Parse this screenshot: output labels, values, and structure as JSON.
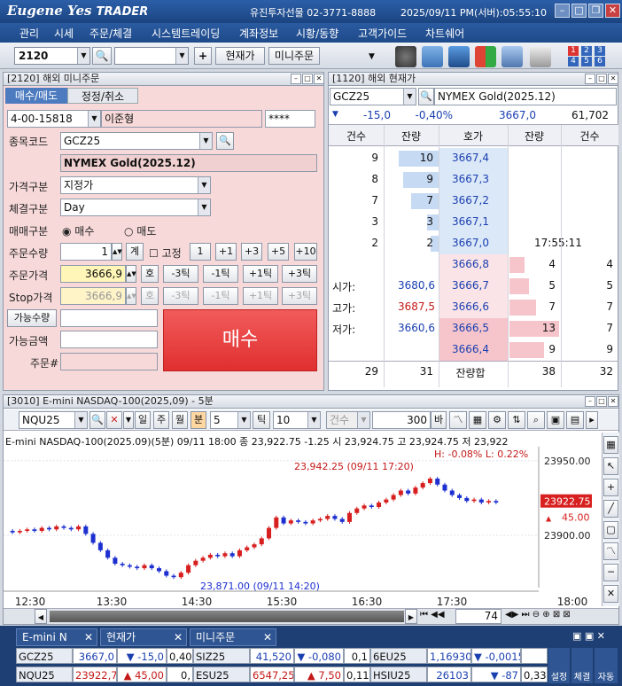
{
  "app": {
    "logo_main": "Eugene Yes",
    "logo_sub": "TRADER",
    "company": "유진투자선물 02-3771-8888",
    "datetime": "2025/09/11  PM(서버):05:55:10"
  },
  "menu": [
    "관리",
    "시세",
    "주문/체결",
    "시스템트레이딩",
    "계좌정보",
    "시황/동향",
    "고객가이드",
    "차트쉐어"
  ],
  "toolbar": {
    "screen_no": "2120",
    "btn_price": "현재가",
    "btn_mini": "미니주문",
    "numgrid": [
      "1",
      "2",
      "3",
      "4",
      "5",
      "6"
    ]
  },
  "order": {
    "title": "[2120] 해외 미니주문",
    "tab_buy": "매수/매도",
    "tab_modify": "정정/취소",
    "account": "4-00-15818",
    "name": "이준형",
    "password": "****",
    "lbl_code": "종목코드",
    "code": "GCZ25",
    "product": "NYMEX Gold(2025.12)",
    "lbl_pricetype": "가격구분",
    "pricetype": "지정가",
    "lbl_fill": "체결구분",
    "fill": "Day",
    "lbl_side": "매매구분",
    "buy": "매수",
    "sell": "매도",
    "lbl_qty": "주문수량",
    "qty": "1",
    "qty_btn": "계",
    "fix": "고정",
    "qty_btns": [
      "1",
      "+1",
      "+3",
      "+5",
      "+10"
    ],
    "lbl_price": "주문가격",
    "price": "3666,9",
    "ho": "호",
    "tick_btns": [
      "-3틱",
      "-1틱",
      "+1틱",
      "+3틱"
    ],
    "lbl_stop": "Stop가격",
    "stop": "3666,9",
    "lbl_avail_qty": "가능수량",
    "lbl_avail_amt": "가능금액",
    "lbl_order_no": "주문#",
    "submit": "매수"
  },
  "price": {
    "title": "[1120] 해외 현재가",
    "code": "GCZ25",
    "product": "NYMEX Gold(2025.12)",
    "change": "-15,0",
    "pct": "-0,40%",
    "last": "3667,0",
    "volume": "61,702",
    "headers": [
      "건수",
      "잔량",
      "호가",
      "잔량",
      "건수"
    ],
    "asks": [
      {
        "cnt": "9",
        "qty": "10",
        "price": "3667,4",
        "q": 10
      },
      {
        "cnt": "8",
        "qty": "9",
        "price": "3667,3",
        "q": 9
      },
      {
        "cnt": "7",
        "qty": "7",
        "price": "3667,2",
        "q": 7
      },
      {
        "cnt": "3",
        "qty": "3",
        "price": "3667,1",
        "q": 3
      },
      {
        "cnt": "2",
        "qty": "2",
        "price": "3667,0",
        "q": 2
      }
    ],
    "time": "17:55:11",
    "bids": [
      {
        "price": "3666,8",
        "qty": "4",
        "cnt": "4",
        "q": 4
      },
      {
        "price": "3666,7",
        "qty": "5",
        "cnt": "5",
        "q": 5
      },
      {
        "price": "3666,6",
        "qty": "7",
        "cnt": "7",
        "q": 7
      },
      {
        "price": "3666,5",
        "qty": "13",
        "cnt": "7",
        "q": 13
      },
      {
        "price": "3666,4",
        "qty": "9",
        "cnt": "9",
        "q": 9
      }
    ],
    "open_lbl": "시가:",
    "open": "3680,6",
    "high_lbl": "고가:",
    "high": "3687,5",
    "low_lbl": "저가:",
    "low": "3660,6",
    "tot": {
      "cnt_l": "29",
      "qty_l": "31",
      "label": "잔량합",
      "qty_r": "38",
      "cnt_r": "32"
    }
  },
  "chart": {
    "title": "[3010] E-mini NASDAQ-100(2025,09) - 5분",
    "code": "NQU25",
    "period_btns": [
      "일",
      "주",
      "월",
      "분"
    ],
    "interval": "5",
    "tick_lbl": "틱",
    "tick_val": "10",
    "count_lbl": "건수",
    "count_val": "300",
    "ba": "바",
    "header": "E-mini NASDAQ-100(2025.09)(5분) 09/11 18:00  종 23,922.75 -1.25  시 23,924.75 고 23,924.75 저 23,922",
    "hl_note": "H: -0.08%   L: 0.22%",
    "high_annot": "23,942.25 (09/11 17:20)",
    "low_annot": "23,871.00 (09/11 14:20)",
    "current": "23922.75",
    "current_chg": "45.00",
    "scroll_val": "74"
  },
  "chart_data": {
    "type": "candlestick",
    "x_ticks": [
      "12:30",
      "13:30",
      "14:30",
      "15:30",
      "16:30",
      "17:30",
      "18:00"
    ],
    "y_ticks": [
      "23950.00",
      "23900.00"
    ],
    "ylim": [
      23865,
      23957
    ],
    "close": [
      23902,
      23903,
      23904,
      23903,
      23905,
      23904,
      23906,
      23905,
      23904,
      23906,
      23901,
      23895,
      23890,
      23885,
      23881,
      23880,
      23879,
      23878,
      23880,
      23878,
      23876,
      23873,
      23872,
      23875,
      23880,
      23883,
      23885,
      23887,
      23886,
      23888,
      23886,
      23890,
      23892,
      23894,
      23898,
      23905,
      23912,
      23908,
      23910,
      23909,
      23908,
      23910,
      23911,
      23913,
      23911,
      23909,
      23915,
      23918,
      23920,
      23919,
      23922,
      23924,
      23927,
      23930,
      23928,
      23932,
      23935,
      23938,
      23934,
      23930,
      23927,
      23925,
      23923,
      23924,
      23922,
      23923,
      23922
    ]
  },
  "bottom": {
    "tabs": [
      "E-mini N",
      "현재가",
      "미니주문"
    ],
    "row1": [
      {
        "sym": "GCZ25",
        "p": "3667,0",
        "c": "▼ -15,0",
        "pct": "0,40"
      },
      {
        "sym": "SIZ25",
        "p": "41,520",
        "c": "▼ -0,080",
        "pct": "0,1"
      },
      {
        "sym": "6EU25",
        "p": "1,16930",
        "c": "▼ -0,00155",
        "pct": ""
      }
    ],
    "row2": [
      {
        "sym": "NQU25",
        "p": "23922,75",
        "c": "▲ 45,00",
        "pct": "0,"
      },
      {
        "sym": "ESU25",
        "p": "6547,25",
        "c": "▲ 7,50",
        "pct": "0,11"
      },
      {
        "sym": "HSIU25",
        "p": "26103",
        "c": "▼ -87",
        "pct": "0,33 %"
      }
    ],
    "side": [
      "설정",
      "체결",
      "자동"
    ]
  }
}
